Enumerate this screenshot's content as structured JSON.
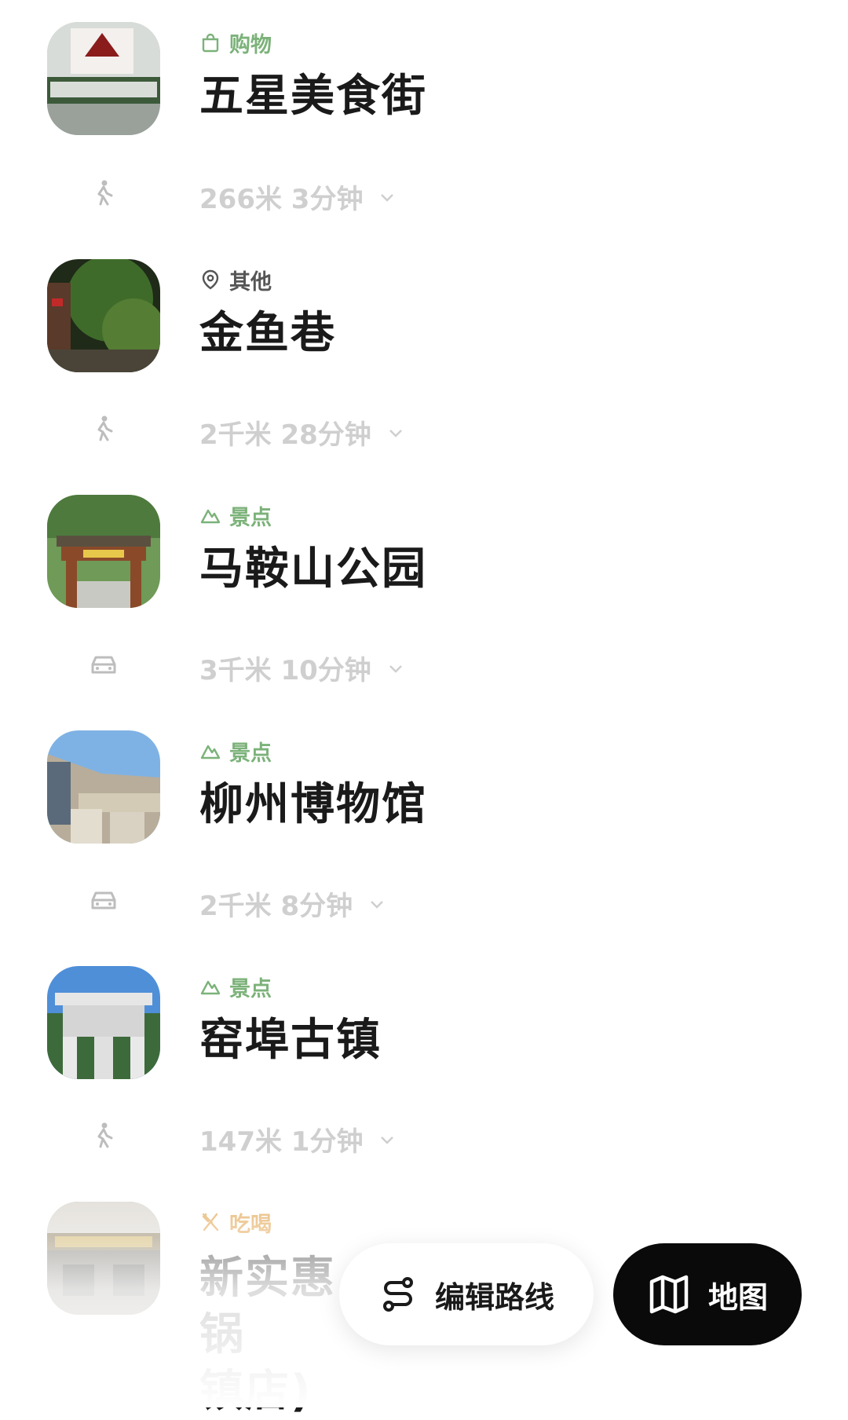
{
  "colors": {
    "category_green": "#7cb27a",
    "category_orange": "#e0a24a",
    "transit_gray": "#cfcfcf",
    "title_black": "#1a1a1a",
    "map_button_bg": "#0a0a0a"
  },
  "stops": [
    {
      "category": "购物",
      "category_icon": "shopping-bag-icon",
      "title": "五星美食街"
    },
    {
      "category": "其他",
      "category_icon": "location-pin-icon",
      "title": "金鱼巷"
    },
    {
      "category": "景点",
      "category_icon": "mountain-icon",
      "title": "马鞍山公园"
    },
    {
      "category": "景点",
      "category_icon": "mountain-icon",
      "title": "柳州博物馆"
    },
    {
      "category": "景点",
      "category_icon": "mountain-icon",
      "title": "窑埠古镇"
    },
    {
      "category": "吃喝",
      "category_icon": "utensils-icon",
      "title": "新实惠",
      "title_tail": "锅",
      "title_line2": "镇店)"
    }
  ],
  "transits": [
    {
      "mode": "walk-icon",
      "text": "266米 3分钟"
    },
    {
      "mode": "walk-icon",
      "text": "2千米 28分钟"
    },
    {
      "mode": "car-icon",
      "text": "3千米 10分钟"
    },
    {
      "mode": "car-icon",
      "text": "2千米 8分钟"
    },
    {
      "mode": "walk-icon",
      "text": "147米 1分钟"
    }
  ],
  "buttons": {
    "edit_route": "编辑路线",
    "edit_route_icon": "route-icon",
    "map": "地图",
    "map_icon": "map-icon"
  }
}
